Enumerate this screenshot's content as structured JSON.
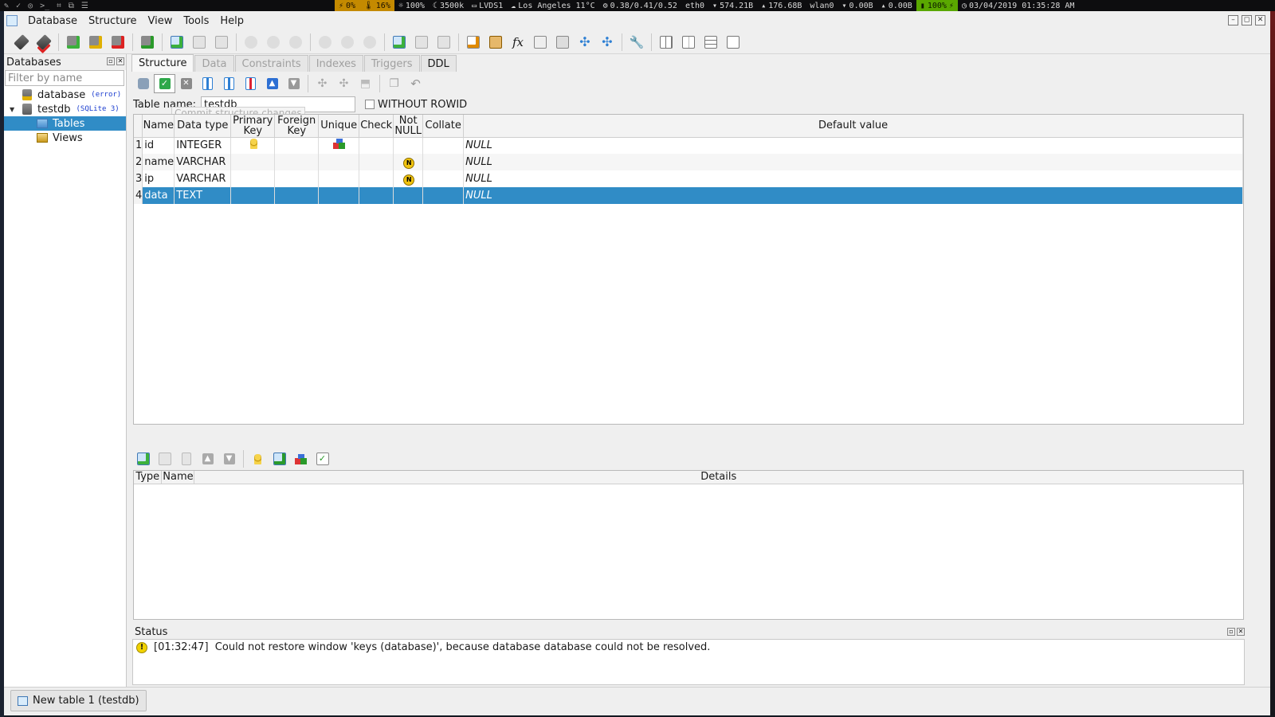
{
  "sysbar": {
    "cpu": "0%",
    "temp": "16%",
    "brightness": "100%",
    "cpu_freq": "3500k",
    "display": "LVDS1",
    "weather": "Los Angeles 11°C",
    "load": "0.38/0.41/0.52",
    "eth_iface": "eth0",
    "eth_down": "574.21B",
    "eth_up": "176.68B",
    "wlan_iface": "wlan0",
    "wlan_down": "0.00B",
    "wlan_up": "0.00B",
    "battery": "100%",
    "datetime": "03/04/2019 01:35:28 AM"
  },
  "menubar": {
    "items": [
      "Database",
      "Structure",
      "View",
      "Tools",
      "Help"
    ]
  },
  "dock": {
    "title": "Databases",
    "filter_placeholder": "Filter by name",
    "tree": [
      {
        "label": "database",
        "tag": "(error)"
      },
      {
        "label": "testdb",
        "tag": "(SQLite 3)"
      },
      {
        "label": "Tables"
      },
      {
        "label": "Views"
      }
    ]
  },
  "tabs": [
    "Structure",
    "Data",
    "Constraints",
    "Indexes",
    "Triggers",
    "DDL"
  ],
  "tooltip": "Commit structure changes",
  "table_name_label": "Table name:",
  "table_name_value": "testdb",
  "without_rowid_label": "WITHOUT ROWID",
  "columns_header": [
    "Name",
    "Data type",
    "Primary Key",
    "Foreign Key",
    "Unique",
    "Check",
    "Not NULL",
    "Collate",
    "Default value"
  ],
  "rows": [
    {
      "n": "1",
      "name": "id",
      "type": "INTEGER",
      "pk": true,
      "unique": true,
      "notnull": false,
      "default": "NULL"
    },
    {
      "n": "2",
      "name": "name",
      "type": "VARCHAR",
      "pk": false,
      "unique": false,
      "notnull": true,
      "default": "NULL"
    },
    {
      "n": "3",
      "name": "ip",
      "type": "VARCHAR",
      "pk": false,
      "unique": false,
      "notnull": true,
      "default": "NULL"
    },
    {
      "n": "4",
      "name": "data",
      "type": "TEXT",
      "pk": false,
      "unique": false,
      "notnull": false,
      "default": "NULL"
    }
  ],
  "constraints_header": [
    "Type",
    "Name",
    "Details"
  ],
  "status": {
    "title": "Status",
    "message": "[01:32:47]  Could not restore window 'keys (database)', because database database could not be resolved."
  },
  "taskbar": {
    "button": "New table 1 (testdb)"
  },
  "colors": {
    "selection": "#308cc6",
    "tag_blue": "#1a3ccf"
  }
}
